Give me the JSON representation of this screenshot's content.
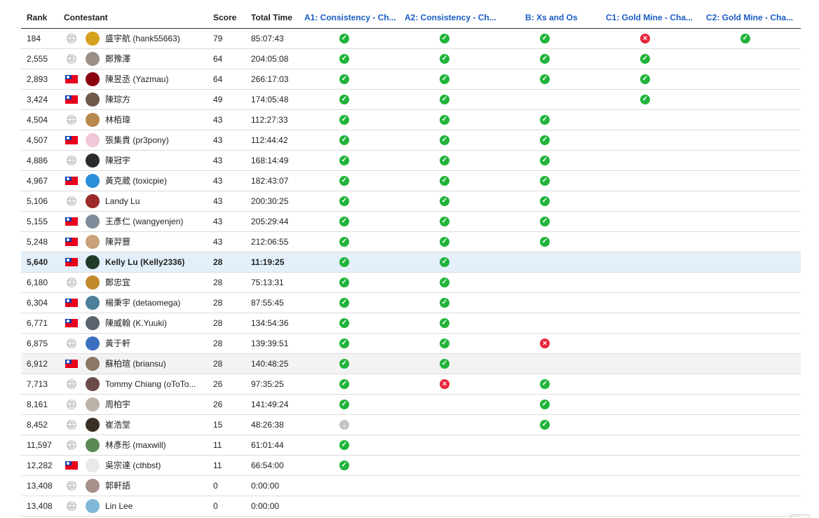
{
  "headers": {
    "rank": "Rank",
    "contestant": "Contestant",
    "score": "Score",
    "total_time": "Total Time",
    "problems": [
      "A1: Consistency - Ch...",
      "A2: Consistency - Ch...",
      "B: Xs and Os",
      "C1: Gold Mine - Cha...",
      "C2: Gold Mine - Cha..."
    ]
  },
  "colors": {
    "accent": "#1a5bc4",
    "ok": "#20b43a",
    "bad": "#e8263a",
    "highlight": "#e3f0fb"
  },
  "rows": [
    {
      "rank": "184",
      "flag": "globe",
      "avatar": "#d7a21f",
      "name": "盛宇航 (hank55663)",
      "score": "79",
      "time": "85:07:43",
      "results": [
        "ok",
        "ok",
        "ok",
        "bad",
        "ok"
      ]
    },
    {
      "rank": "2,555",
      "flag": "globe",
      "avatar": "#9a8f86",
      "name": "鄭豫澤",
      "score": "64",
      "time": "204:05:08",
      "results": [
        "ok",
        "ok",
        "ok",
        "ok",
        ""
      ]
    },
    {
      "rank": "2,893",
      "flag": "taiwan",
      "avatar": "#8b0010",
      "name": "陳昱丞 (Yazmau)",
      "score": "64",
      "time": "266:17:03",
      "results": [
        "ok",
        "ok",
        "ok",
        "ok",
        ""
      ]
    },
    {
      "rank": "3,424",
      "flag": "taiwan",
      "avatar": "#6f5a4b",
      "name": "陳琮方",
      "score": "49",
      "time": "174:05:48",
      "results": [
        "ok",
        "ok",
        "",
        "ok",
        ""
      ]
    },
    {
      "rank": "4,504",
      "flag": "globe",
      "avatar": "#b7894d",
      "name": "林栢瑋",
      "score": "43",
      "time": "112:27:33",
      "results": [
        "ok",
        "ok",
        "ok",
        "",
        ""
      ]
    },
    {
      "rank": "4,507",
      "flag": "taiwan",
      "avatar": "#f1c6d8",
      "name": "張集貴 (pr3pony)",
      "score": "43",
      "time": "112:44:42",
      "results": [
        "ok",
        "ok",
        "ok",
        "",
        ""
      ]
    },
    {
      "rank": "4,886",
      "flag": "globe",
      "avatar": "#2b2b2b",
      "name": "陳冠宇",
      "score": "43",
      "time": "168:14:49",
      "results": [
        "ok",
        "ok",
        "ok",
        "",
        ""
      ]
    },
    {
      "rank": "4,967",
      "flag": "taiwan",
      "avatar": "#2a8fd8",
      "name": "黃克葳 (toxicpie)",
      "score": "43",
      "time": "182:43:07",
      "results": [
        "ok",
        "ok",
        "ok",
        "",
        ""
      ]
    },
    {
      "rank": "5,106",
      "flag": "globe",
      "avatar": "#9c2a2a",
      "name": "Landy Lu",
      "score": "43",
      "time": "200:30:25",
      "results": [
        "ok",
        "ok",
        "ok",
        "",
        ""
      ]
    },
    {
      "rank": "5,155",
      "flag": "taiwan",
      "avatar": "#7e8b99",
      "name": "王彥仁 (wangyenjen)",
      "score": "43",
      "time": "205:29:44",
      "results": [
        "ok",
        "ok",
        "ok",
        "",
        ""
      ]
    },
    {
      "rank": "5,248",
      "flag": "taiwan",
      "avatar": "#c9a27b",
      "name": "陳羿豐",
      "score": "43",
      "time": "212:06:55",
      "results": [
        "ok",
        "ok",
        "ok",
        "",
        ""
      ]
    },
    {
      "rank": "5,640",
      "flag": "taiwan",
      "avatar": "#1f3b2a",
      "name": "Kelly Lu (Kelly2336)",
      "score": "28",
      "time": "11:19:25",
      "results": [
        "ok",
        "ok",
        "",
        "",
        ""
      ],
      "me": true
    },
    {
      "rank": "6,180",
      "flag": "globe",
      "avatar": "#c08a2d",
      "name": "鄭忠宜",
      "score": "28",
      "time": "75:13:31",
      "results": [
        "ok",
        "ok",
        "",
        "",
        ""
      ]
    },
    {
      "rank": "6,304",
      "flag": "taiwan",
      "avatar": "#4d7f9a",
      "name": "楊秉宇 (detaomega)",
      "score": "28",
      "time": "87:55:45",
      "results": [
        "ok",
        "ok",
        "",
        "",
        ""
      ]
    },
    {
      "rank": "6,771",
      "flag": "taiwan",
      "avatar": "#5b6470",
      "name": "陳威翰 (K.Yuuki)",
      "score": "28",
      "time": "134:54:36",
      "results": [
        "ok",
        "ok",
        "",
        "",
        ""
      ]
    },
    {
      "rank": "6,875",
      "flag": "globe",
      "avatar": "#3d6fc1",
      "name": "黃于軒",
      "score": "28",
      "time": "139:39:51",
      "results": [
        "ok",
        "ok",
        "bad",
        "",
        ""
      ]
    },
    {
      "rank": "6,912",
      "flag": "taiwan",
      "avatar": "#8a7766",
      "name": "蘇柏瑄 (briansu)",
      "score": "28",
      "time": "140:48:25",
      "results": [
        "ok",
        "ok",
        "",
        "",
        ""
      ],
      "hover": true
    },
    {
      "rank": "7,713",
      "flag": "globe",
      "avatar": "#6b4b48",
      "name": "Tommy Chiang (oToTo...",
      "score": "26",
      "time": "97:35:25",
      "results": [
        "ok",
        "bad",
        "ok",
        "",
        ""
      ]
    },
    {
      "rank": "8,161",
      "flag": "globe",
      "avatar": "#bbb3a8",
      "name": "周柏宇",
      "score": "26",
      "time": "141:49:24",
      "results": [
        "ok",
        "",
        "ok",
        "",
        ""
      ]
    },
    {
      "rank": "8,452",
      "flag": "globe",
      "avatar": "#3a2f24",
      "name": "崔浩堂",
      "score": "15",
      "time": "48:26:38",
      "results": [
        "pend",
        "",
        "ok",
        "",
        ""
      ]
    },
    {
      "rank": "11,597",
      "flag": "globe",
      "avatar": "#5a8a55",
      "name": "林彥彤 (maxwill)",
      "score": "11",
      "time": "61:01:44",
      "results": [
        "ok",
        "",
        "",
        "",
        ""
      ]
    },
    {
      "rank": "12,282",
      "flag": "taiwan",
      "avatar": "#e9e9e9",
      "name": "吳宗達 (cthbst)",
      "score": "11",
      "time": "66:54:00",
      "results": [
        "ok",
        "",
        "",
        "",
        ""
      ]
    },
    {
      "rank": "13,408",
      "flag": "globe",
      "avatar": "#a98f89",
      "name": "郭軒語",
      "score": "0",
      "time": "0:00:00",
      "results": [
        "",
        "",
        "",
        "",
        ""
      ]
    },
    {
      "rank": "13,408",
      "flag": "globe",
      "avatar": "#7fb8d6",
      "name": "Lin Lee",
      "score": "0",
      "time": "0:00:00",
      "results": [
        "",
        "",
        "",
        "",
        ""
      ]
    }
  ]
}
